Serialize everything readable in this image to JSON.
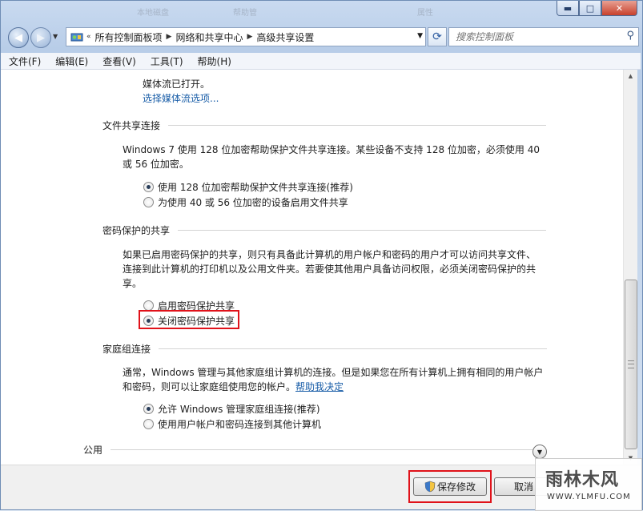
{
  "window": {
    "minimize": "▬",
    "maximize": "□",
    "close": "✕",
    "background_texts": [
      "本地磁盘",
      "帮助管",
      "属性"
    ]
  },
  "nav": {
    "breadcrumbs": [
      "所有控制面板项",
      "网络和共享中心",
      "高级共享设置"
    ],
    "overflow": "«",
    "search_placeholder": "搜索控制面板"
  },
  "menu": [
    "文件(F)",
    "编辑(E)",
    "查看(V)",
    "工具(T)",
    "帮助(H)"
  ],
  "content": {
    "media_text": "媒体流已打开。",
    "media_link": "选择媒体流选项...",
    "file_sharing": {
      "title": "文件共享连接",
      "desc_line1": "Windows 7 使用 128 位加密帮助保护文件共享连接。某些设备不支持 128 位加密，必须使用 40",
      "desc_line2": "或 56 位加密。",
      "options": [
        "使用 128 位加密帮助保护文件共享连接(推荐)",
        "为使用 40 或 56 位加密的设备启用文件共享"
      ],
      "selected": 0
    },
    "password_sharing": {
      "title": "密码保护的共享",
      "desc_line1": "如果已启用密码保护的共享，则只有具备此计算机的用户帐户和密码的用户才可以访问共享文件、",
      "desc_line2": "连接到此计算机的打印机以及公用文件夹。若要使其他用户具备访问权限，必须关闭密码保护的共",
      "desc_line3": "享。",
      "options": [
        "启用密码保护共享",
        "关闭密码保护共享"
      ],
      "selected": 1
    },
    "homegroup": {
      "title": "家庭组连接",
      "desc_line1": "通常，Windows 管理与其他家庭组计算机的连接。但是如果您在所有计算机上拥有相同的用户帐户",
      "desc_line2": "和密码，则可以让家庭组使用您的帐户。",
      "help_link": "帮助我决定",
      "options": [
        "允许 Windows 管理家庭组连接(推荐)",
        "使用用户帐户和密码连接到其他计算机"
      ],
      "selected": 0
    },
    "public": {
      "title": "公用"
    }
  },
  "footer": {
    "save_label": "保存修改",
    "cancel_label": "取消"
  },
  "watermark": {
    "brand": "雨林木风",
    "url": "WWW.YLMFU.COM"
  },
  "colors": {
    "highlight": "#e0121a",
    "link": "#1a5ea8"
  }
}
